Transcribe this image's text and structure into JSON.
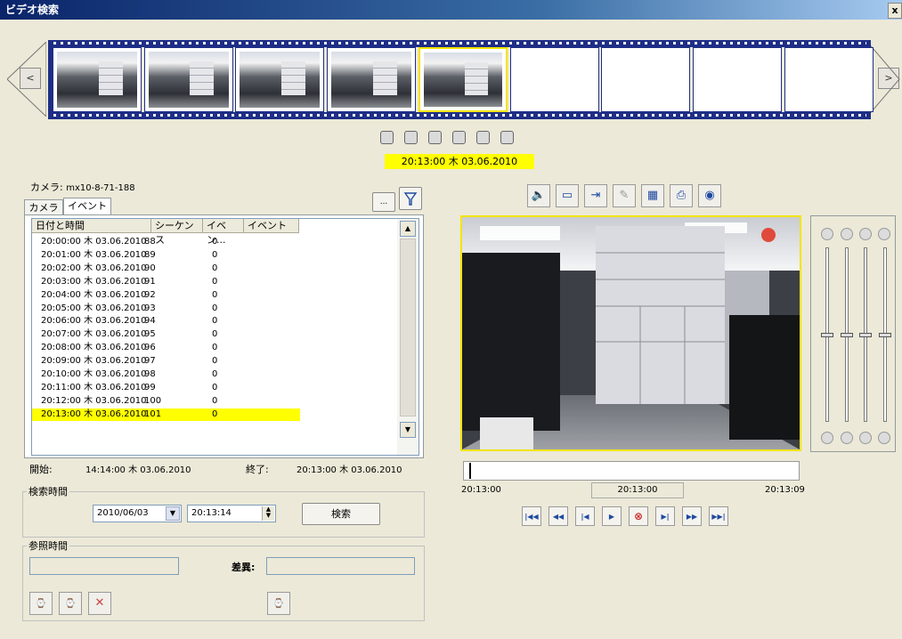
{
  "window": {
    "title": "ビデオ検索",
    "close_label": "x"
  },
  "filmstrip": {
    "prev_label": "<",
    "next_label": ">",
    "frames": [
      {
        "has_image": true
      },
      {
        "has_image": true
      },
      {
        "has_image": true
      },
      {
        "has_image": true
      },
      {
        "has_image": true,
        "selected": true
      },
      {
        "has_image": false
      },
      {
        "has_image": false
      },
      {
        "has_image": false
      },
      {
        "has_image": false
      }
    ],
    "timestamp": "20:13:00 木 03.06.2010"
  },
  "camera": {
    "label": "カメラ:",
    "name": "mx10-8-71-188"
  },
  "tabs": [
    {
      "label": "カメラ"
    },
    {
      "label": "イベント",
      "active": true
    }
  ],
  "tab_buttons": {
    "more_label": "...",
    "filter_icon": "filter-icon"
  },
  "event_table": {
    "columns": [
      "日付と時間",
      "シーケンス",
      "イベン...",
      "イベント"
    ],
    "rows": [
      {
        "time": "20:00:00 木 03.06.2010",
        "seq": "88",
        "ev": "0"
      },
      {
        "time": "20:01:00 木 03.06.2010",
        "seq": "89",
        "ev": "0"
      },
      {
        "time": "20:02:00 木 03.06.2010",
        "seq": "90",
        "ev": "0"
      },
      {
        "time": "20:03:00 木 03.06.2010",
        "seq": "91",
        "ev": "0"
      },
      {
        "time": "20:04:00 木 03.06.2010",
        "seq": "92",
        "ev": "0"
      },
      {
        "time": "20:05:00 木 03.06.2010",
        "seq": "93",
        "ev": "0"
      },
      {
        "time": "20:06:00 木 03.06.2010",
        "seq": "94",
        "ev": "0"
      },
      {
        "time": "20:07:00 木 03.06.2010",
        "seq": "95",
        "ev": "0"
      },
      {
        "time": "20:08:00 木 03.06.2010",
        "seq": "96",
        "ev": "0"
      },
      {
        "time": "20:09:00 木 03.06.2010",
        "seq": "97",
        "ev": "0"
      },
      {
        "time": "20:10:00 木 03.06.2010",
        "seq": "98",
        "ev": "0"
      },
      {
        "time": "20:11:00 木 03.06.2010",
        "seq": "99",
        "ev": "0"
      },
      {
        "time": "20:12:00 木 03.06.2010",
        "seq": "100",
        "ev": "0"
      },
      {
        "time": "20:13:00 木 03.06.2010",
        "seq": "101",
        "ev": "0",
        "highlight": true
      }
    ]
  },
  "range": {
    "start_label": "開始:",
    "start_value": "14:14:00 木 03.06.2010",
    "end_label": "終了:",
    "end_value": "20:13:00 木 03.06.2010"
  },
  "search_time": {
    "group_label": "検索時間",
    "date": "2010/06/03",
    "time": "20:13:14",
    "search_button": "検索"
  },
  "reference_time": {
    "group_label": "参照時間",
    "ref_value": "",
    "diff_label": "差異:",
    "diff_value": ""
  },
  "toolbar": {
    "icons": [
      "speaker-icon",
      "fullscreen-icon",
      "export-clip-icon",
      "edit-icon",
      "snapshot-icon",
      "print-icon",
      "camera-settings-icon"
    ]
  },
  "timeline": {
    "start": "20:13:00",
    "current": "20:13:00",
    "end": "20:13:09",
    "progress": 0.0
  },
  "playback": {
    "icons": [
      "skip-to-start-icon",
      "rewind-icon",
      "step-back-icon",
      "play-icon",
      "live-icon",
      "step-forward-icon",
      "fast-forward-icon",
      "skip-to-end-icon"
    ],
    "glyphs": [
      "|◀◀",
      "◀◀",
      "|◀",
      "▶",
      "⊗",
      "▶|",
      "▶▶",
      "▶▶|"
    ]
  },
  "image_adjust": {
    "sliders": [
      {
        "name": "brightness",
        "level": 0.5
      },
      {
        "name": "sun",
        "level": 0.5
      },
      {
        "name": "contrast",
        "level": 0.5
      },
      {
        "name": "saturation",
        "level": 0.5
      }
    ]
  },
  "colors": {
    "highlight": "#ffff00",
    "film": "#1e2e86",
    "title_bar": "#0a246a"
  }
}
